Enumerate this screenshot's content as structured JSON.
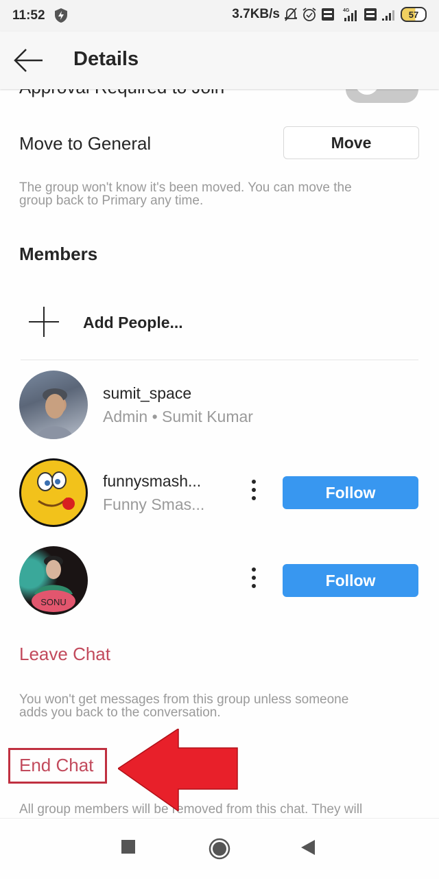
{
  "status_bar": {
    "time": "11:52",
    "speed": "3.7KB/s",
    "battery": "57",
    "icons": [
      "shield-bolt-icon",
      "mute-bell-icon",
      "alarm-icon",
      "volte-icon",
      "signal-4g-icon",
      "volte-icon",
      "signal-icon",
      "battery-icon"
    ]
  },
  "header": {
    "back_icon": "arrow-left-icon",
    "title": "Details"
  },
  "settings": {
    "approval_label": "Approval Required to Join",
    "approval_enabled": false,
    "move_label": "Move to General",
    "move_button": "Move",
    "move_hint_line1": "The group won't know it's been moved. You can move the",
    "move_hint_line2": "group back to Primary any time."
  },
  "members": {
    "title": "Members",
    "add_label": "Add People...",
    "list": [
      {
        "username": "sumit_space",
        "subtitle": "Admin • Sumit Kumar",
        "follow": null
      },
      {
        "username": "funnysmash...",
        "subtitle": "Funny Smas...",
        "follow": "Follow"
      },
      {
        "username": "",
        "subtitle": "",
        "avatar_text": "SONU",
        "follow": "Follow"
      }
    ]
  },
  "actions": {
    "leave_label": "Leave Chat",
    "leave_hint_line1": "You won't get messages from this group unless someone",
    "leave_hint_line2": "adds you back to the conversation.",
    "end_label": "End Chat",
    "end_hint_line1": "All group members will be removed from this chat. They will"
  },
  "colors": {
    "accent_blue": "#3897f0",
    "danger": "#c24a5c",
    "annotation_red": "#e8202a"
  },
  "nav": {
    "recents": "square-icon",
    "home": "circle-home-icon",
    "back": "triangle-back-icon"
  }
}
